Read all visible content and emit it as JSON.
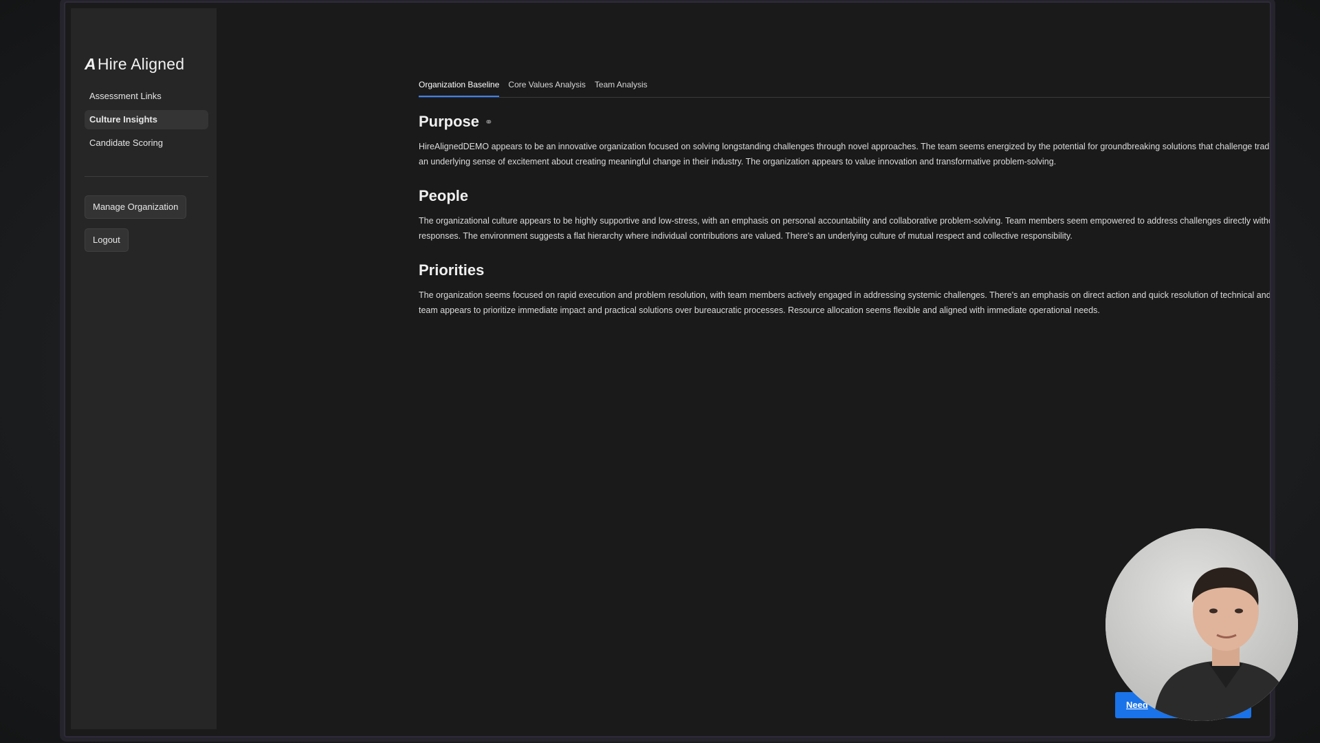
{
  "brand": {
    "name": "Hire Aligned",
    "logo_mark": "A"
  },
  "sidebar": {
    "items": [
      {
        "label": "Assessment Links"
      },
      {
        "label": "Culture Insights"
      },
      {
        "label": "Candidate Scoring"
      }
    ],
    "manage_label": "Manage Organization",
    "logout_label": "Logout"
  },
  "tabs": [
    {
      "label": "Organization Baseline"
    },
    {
      "label": "Core Values Analysis"
    },
    {
      "label": "Team Analysis"
    }
  ],
  "sections": {
    "purpose": {
      "title": "Purpose",
      "body": "HireAlignedDEMO appears to be an innovative organization focused on solving longstanding challenges through novel approaches. The team seems energized by the potential for groundbreaking solutions that challenge traditional methods. There's an underlying sense of excitement about creating meaningful change in their industry. The organization appears to value innovation and transformative problem-solving."
    },
    "people": {
      "title": "People",
      "body": "The organizational culture appears to be highly supportive and low-stress, with an emphasis on personal accountability and collaborative problem-solving. Team members seem empowered to address challenges directly without fear of punitive responses. The environment suggests a flat hierarchy where individual contributions are valued. There's an underlying culture of mutual respect and collective responsibility."
    },
    "priorities": {
      "title": "Priorities",
      "body": "The organization seems focused on rapid execution and problem resolution, with team members actively engaged in addressing systemic challenges. There's an emphasis on direct action and quick resolution of technical and operational issues. The team appears to prioritize immediate impact and practical solutions over bureaucratic processes. Resource allocation seems flexible and aligned with immediate operational needs."
    }
  },
  "help_button_label": "Need",
  "colors": {
    "accent": "#3b82f6",
    "help_button": "#1a73e8",
    "background": "#1a1a1a",
    "sidebar": "#262626"
  },
  "icons": {
    "link": "link-icon"
  }
}
